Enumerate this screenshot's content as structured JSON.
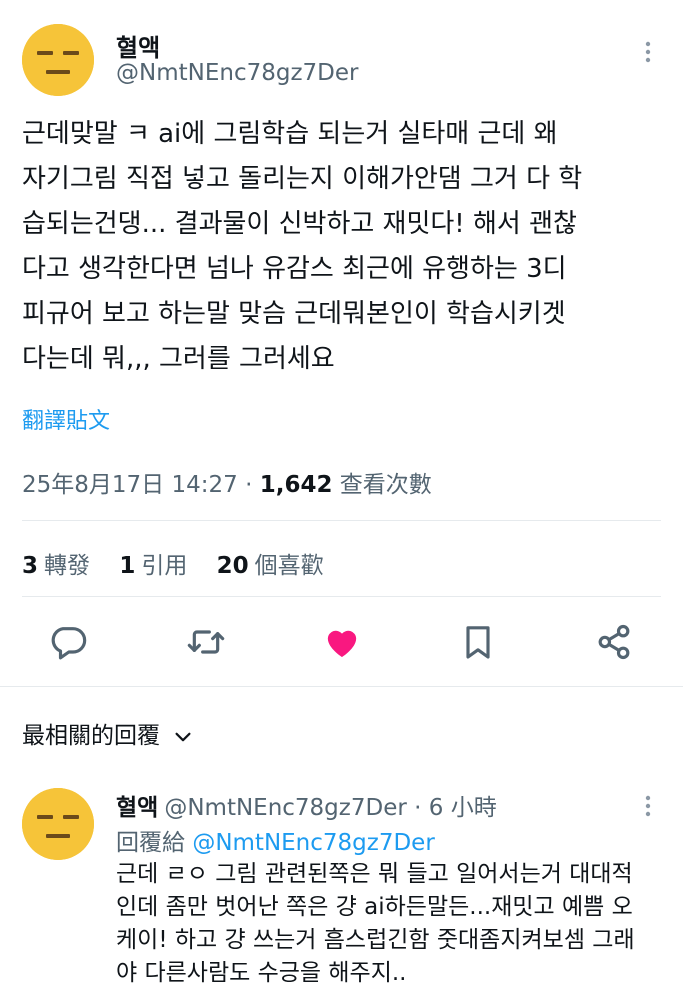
{
  "tweet": {
    "author_name": "혈액",
    "author_handle": "@NmtNEnc78gz7Der",
    "text_lines": [
      "근데맞말 ㅋ ai에 그림학습 되는거 실타매 근데 왜",
      "자기그림 직접 넣고 돌리는지 이해가안댐 그거 다 학",
      "습되는건댕... 결과물이 신박하고 재밋다! 해서 괜찮",
      "다고 생각한다면 넘나 유감스 최근에 유행하는 3디",
      "피규어 보고 하는말 맞슴 근데뭐본인이 학습시키겟",
      "다는데 뭐,,, 그러를 그러세요"
    ],
    "translate_label": "翻譯貼文",
    "timestamp": "25年8月17日 14:27",
    "separator": " · ",
    "views_count": "1,642",
    "views_label": " 查看次數",
    "stats": {
      "reposts_count": "3",
      "reposts_label": "轉發",
      "quotes_count": "1",
      "quotes_label": "引用",
      "likes_count": "20",
      "likes_label": "個喜歡"
    }
  },
  "actions": {
    "reply_icon": "reply-icon",
    "retweet_icon": "retweet-icon",
    "like_icon": "heart-icon",
    "bookmark_icon": "bookmark-icon",
    "share_icon": "share-icon",
    "like_color": "#f91880",
    "icon_color": "#536471"
  },
  "replies_header": {
    "label": "最相關的回覆"
  },
  "reply": {
    "author_name": "혈액",
    "author_handle": "@NmtNEnc78gz7Der",
    "time": "· 6 小時",
    "replying_to_label": "回覆給 ",
    "replying_to_handle": "@NmtNEnc78gz7Der",
    "text_lines": [
      "근데 ㄹㅇ 그림 관련된쪽은 뭐 들고 일어서는거 대대적",
      "인데 좀만 벗어난 쪽은 걍 ai하든말든...재밋고 예쁨 오",
      "케이! 하고 걍 쓰는거 흠스럽긴함 줏대좀지켜보셈 그래",
      "야 다른사람도 수긍을 해주지.."
    ]
  },
  "colors": {
    "accent": "#1d9bf0",
    "secondary_text": "#536471",
    "avatar": "#f6c439"
  }
}
